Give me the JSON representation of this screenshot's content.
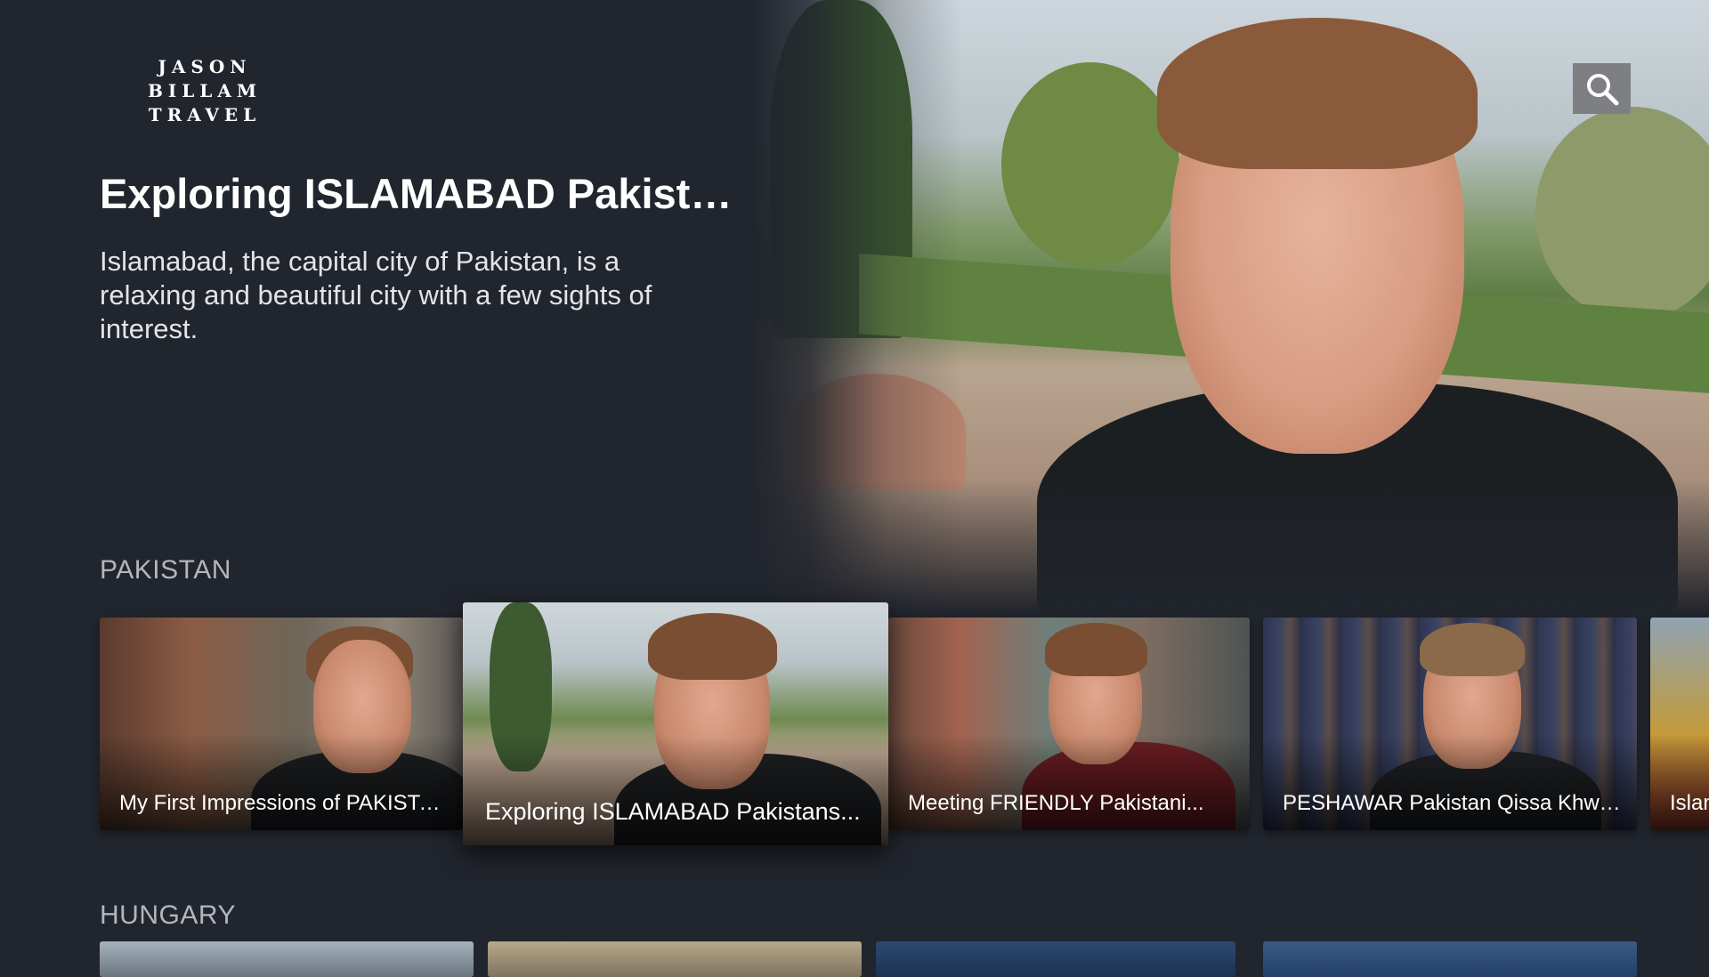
{
  "brand": {
    "line1": "JASON BILLAM",
    "line2": "TRAVEL"
  },
  "search": {
    "icon": "search-icon"
  },
  "hero": {
    "title": "Exploring ISLAMABAD Pakista...",
    "description": "Islamabad, the capital city of Pakistan, is a relaxing and beautiful city with a few sights of interest."
  },
  "rows": [
    {
      "title": "PAKISTAN",
      "cards": [
        {
          "label": "My First Impressions of PAKISTAN"
        },
        {
          "label": "Exploring ISLAMABAD Pakistans...",
          "focused": true
        },
        {
          "label": "Meeting FRIENDLY Pakistani..."
        },
        {
          "label": "PESHAWAR Pakistan Qissa Khwa..."
        },
        {
          "label": "Islam"
        }
      ]
    },
    {
      "title": "HUNGARY"
    }
  ],
  "colors": {
    "background": "#21252d",
    "search_button": "#7d7f82",
    "row_title": "#b3b6bb"
  }
}
